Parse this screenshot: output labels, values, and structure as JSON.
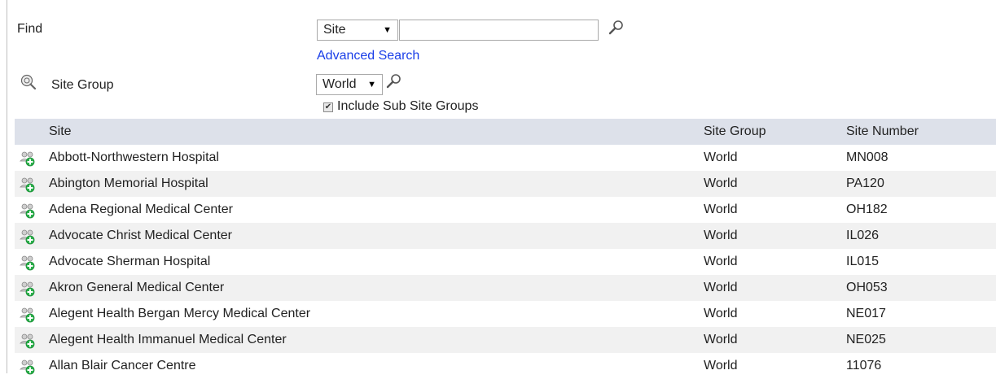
{
  "search": {
    "find_label": "Find",
    "type_select": "Site",
    "query_value": "",
    "advanced_link": "Advanced Search",
    "site_group_label": "Site Group",
    "site_group_select": "World",
    "include_sub_label": "Include Sub Site Groups",
    "include_sub_checked": true
  },
  "table": {
    "headers": {
      "site": "Site",
      "group": "Site Group",
      "number": "Site Number"
    },
    "rows": [
      {
        "site": "Abbott-Northwestern Hospital",
        "group": "World",
        "number": "MN008"
      },
      {
        "site": "Abington Memorial Hospital",
        "group": "World",
        "number": "PA120"
      },
      {
        "site": "Adena Regional Medical Center",
        "group": "World",
        "number": "OH182"
      },
      {
        "site": "Advocate Christ Medical Center",
        "group": "World",
        "number": "IL026"
      },
      {
        "site": "Advocate Sherman Hospital",
        "group": "World",
        "number": "IL015"
      },
      {
        "site": "Akron General Medical Center",
        "group": "World",
        "number": "OH053"
      },
      {
        "site": "Alegent Health Bergan Mercy Medical Center",
        "group": "World",
        "number": "NE017"
      },
      {
        "site": "Alegent Health Immanuel Medical Center",
        "group": "World",
        "number": "NE025"
      },
      {
        "site": "Allan Blair Cancer Centre",
        "group": "World",
        "number": "11076"
      }
    ]
  },
  "icons": {
    "search": "magnifier-icon",
    "site_group": "site-group-icon",
    "row": "site-add-icon"
  }
}
